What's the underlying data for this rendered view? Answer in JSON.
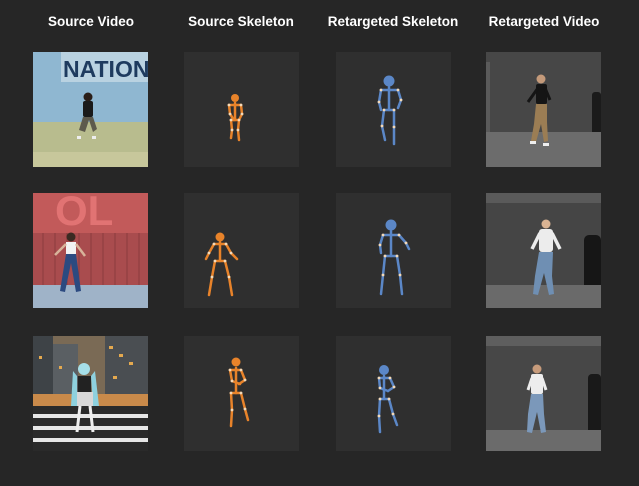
{
  "headers": {
    "col1": "Source Video",
    "col2": "Source Skeleton",
    "col3": "Retargeted Skeleton",
    "col4": "Retargeted Video"
  },
  "colors": {
    "background": "#262626",
    "source_skeleton": "#e8832a",
    "retargeted_skeleton": "#5b87c7",
    "joint": "#f3d9b8"
  },
  "rows": [
    {
      "source_video_sign_text": "NATION"
    },
    {
      "source_video_sign_text": "OL"
    },
    {
      "source_video_sign_text": ""
    }
  ]
}
